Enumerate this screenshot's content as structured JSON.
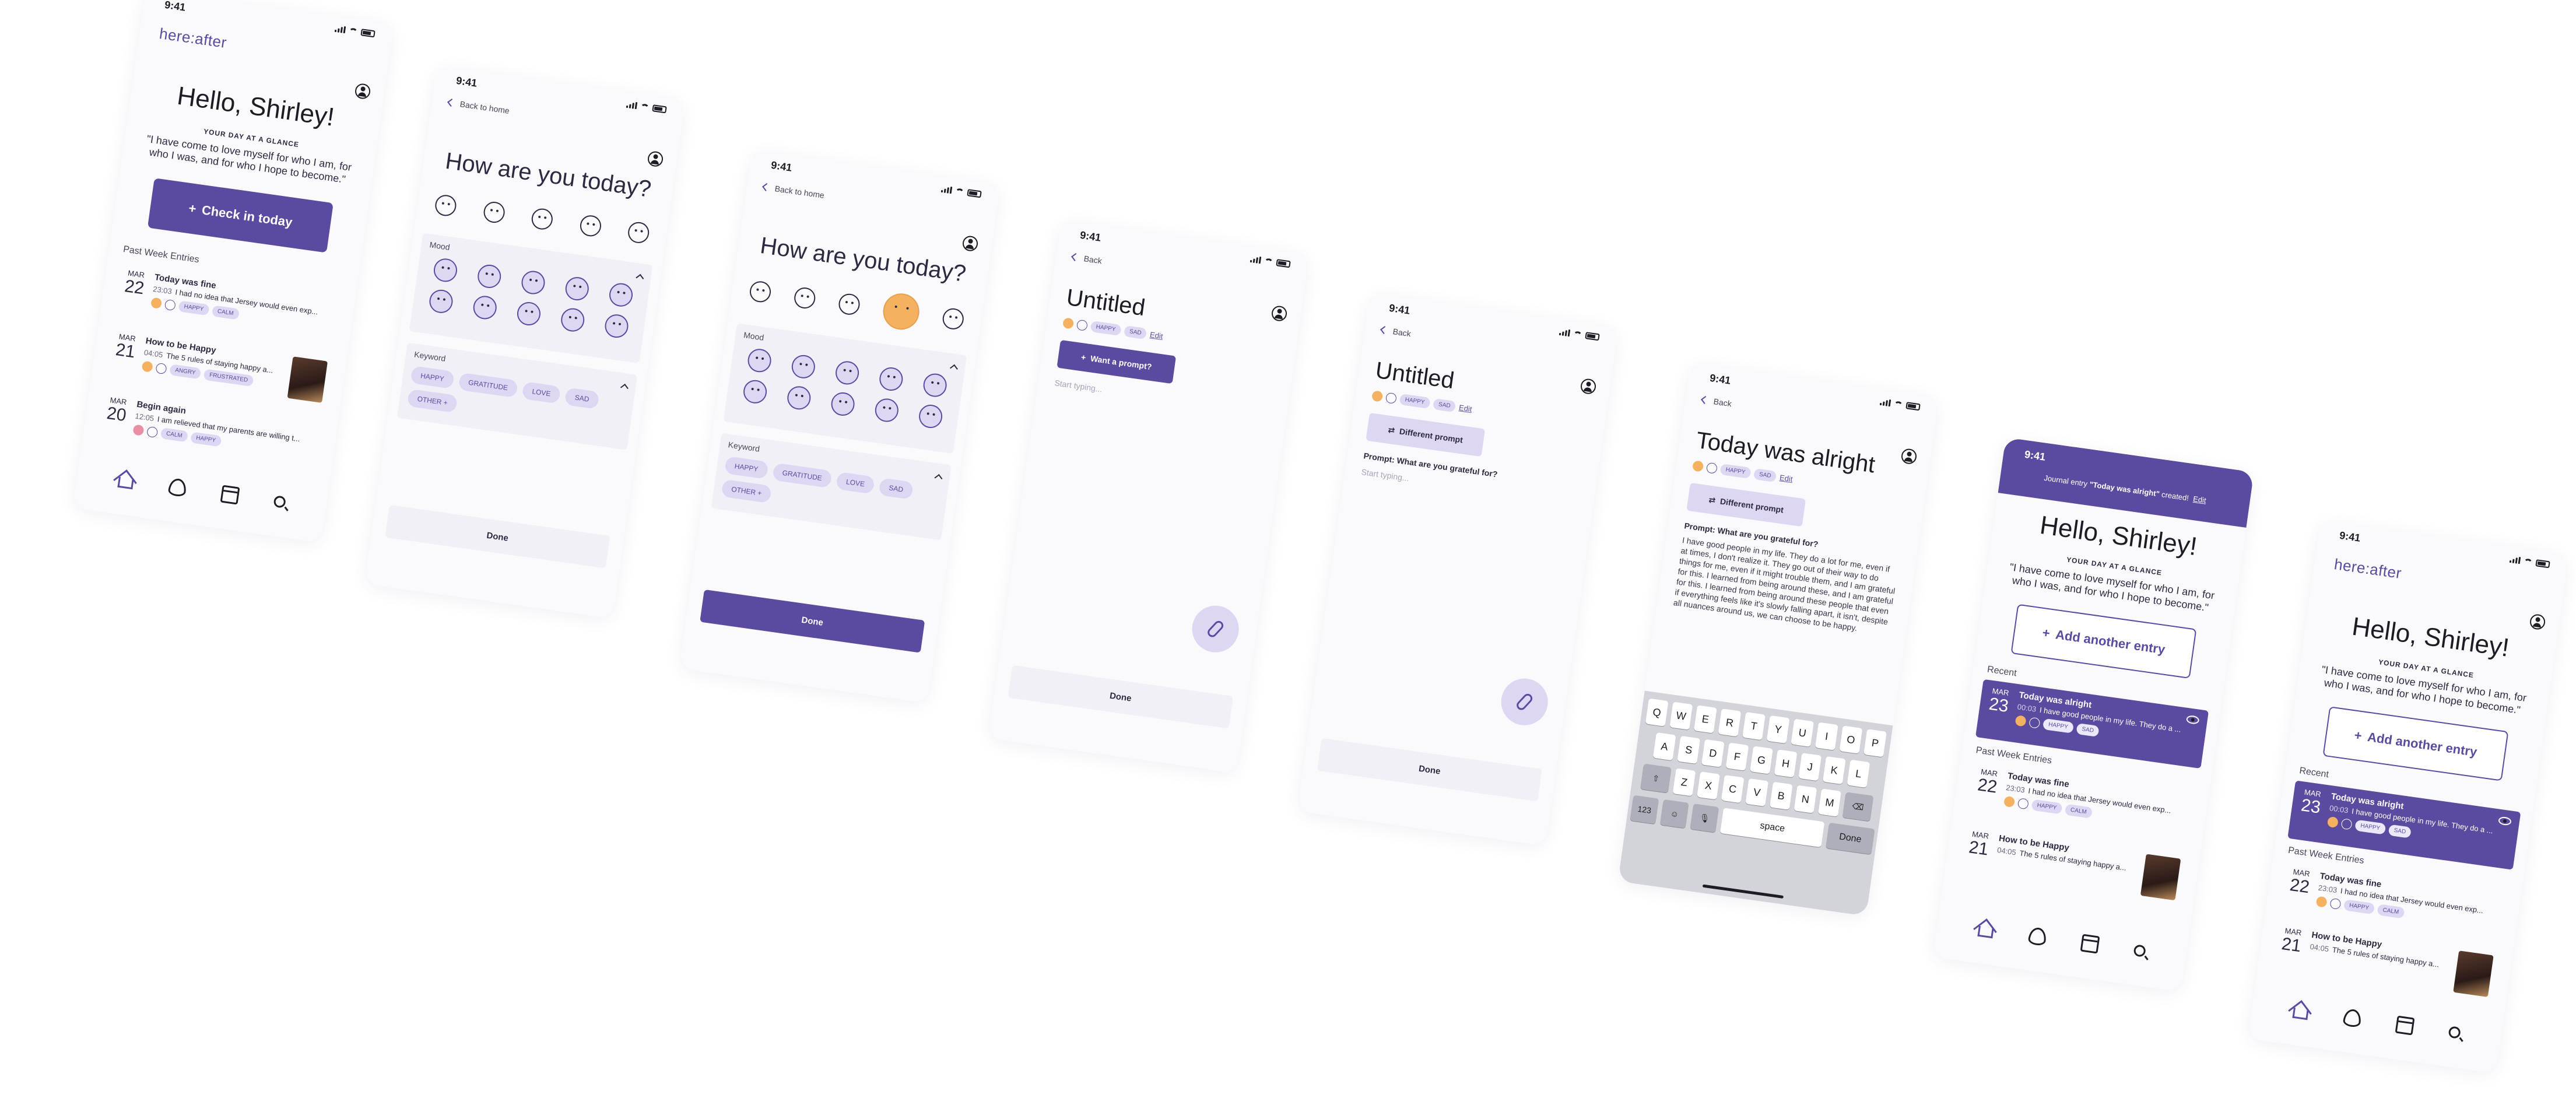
{
  "status_time": "9:41",
  "logo": "here:after",
  "home": {
    "greeting": "Hello, Shirley!",
    "glance_label": "YOUR DAY AT A GLANCE",
    "quote": "\"I have come to love myself for who I am, for who I was, and for who I hope to become.\"",
    "checkin_label": "Check in today",
    "add_entry_label": "Add another entry",
    "recent_label": "Recent",
    "past_week_label": "Past Week Entries"
  },
  "entries": [
    {
      "month": "MAR",
      "day": "23",
      "title": "Today was alright",
      "time": "00:03",
      "preview": "I have good people in my life. They do a ...",
      "chips": [
        "HAPPY",
        "SAD"
      ],
      "dot": "#f4b160"
    },
    {
      "month": "MAR",
      "day": "22",
      "title": "Today was fine",
      "time": "23:03",
      "preview": "I had no idea that Jersey would even exp...",
      "chips": [
        "HAPPY",
        "CALM"
      ],
      "dot": "#f4b160"
    },
    {
      "month": "MAR",
      "day": "21",
      "title": "How to be Happy",
      "time": "04:05",
      "preview": "The 5 rules of staying happy a...",
      "chips": [
        "ANGRY",
        "FRUSTRATED"
      ],
      "dot": "#f4b160"
    },
    {
      "month": "MAR",
      "day": "20",
      "title": "Begin again",
      "time": "12:05",
      "preview": "I am relieved that my parents are willing t...",
      "chips": [
        "CALM",
        "HAPPY"
      ],
      "dot": "#e98fa4"
    }
  ],
  "checkin": {
    "back_label": "Back to home",
    "question": "How are you today?",
    "mood_label": "Mood",
    "keyword_label": "Keyword",
    "keywords": [
      "HAPPY",
      "GRATITUDE",
      "LOVE",
      "SAD",
      "OTHER +"
    ],
    "done_label": "Done"
  },
  "editor": {
    "back_label": "Back",
    "untitled": "Untitled",
    "entry_title": "Today was alright",
    "chips": [
      "HAPPY",
      "SAD"
    ],
    "edit_label": "Edit",
    "want_prompt": "Want a prompt?",
    "different_prompt": "Different prompt",
    "prompt_text": "Prompt: What are you grateful for?",
    "placeholder": "Start typing...",
    "body": "I have good people in my life. They do a lot for me, even if at times, I don't realize it. They go out of their way to do things for me, even if it might trouble them, and I am grateful for this. I learned from being around these, and I am grateful for this. I learned from being around these people that even if everything feels like it's slowly falling apart, it isn't, despite all nuances around us, we can choose to be happy.",
    "done_label": "Done"
  },
  "keyboard": {
    "row1": [
      "Q",
      "W",
      "E",
      "R",
      "T",
      "Y",
      "U",
      "I",
      "O",
      "P"
    ],
    "row2": [
      "A",
      "S",
      "D",
      "F",
      "G",
      "H",
      "J",
      "K",
      "L"
    ],
    "row3": [
      "Z",
      "X",
      "C",
      "V",
      "B",
      "N",
      "M"
    ],
    "num_key": "123",
    "space_key": "space",
    "done_key": "Done"
  },
  "banner": {
    "prefix": "Journal entry",
    "title": "\"Today was alright\"",
    "suffix": "created!",
    "edit": "Edit"
  },
  "colors": {
    "accent": "#5b4a9f",
    "accent_light": "#ddd7f3",
    "mood_selected": "#f4b160"
  }
}
